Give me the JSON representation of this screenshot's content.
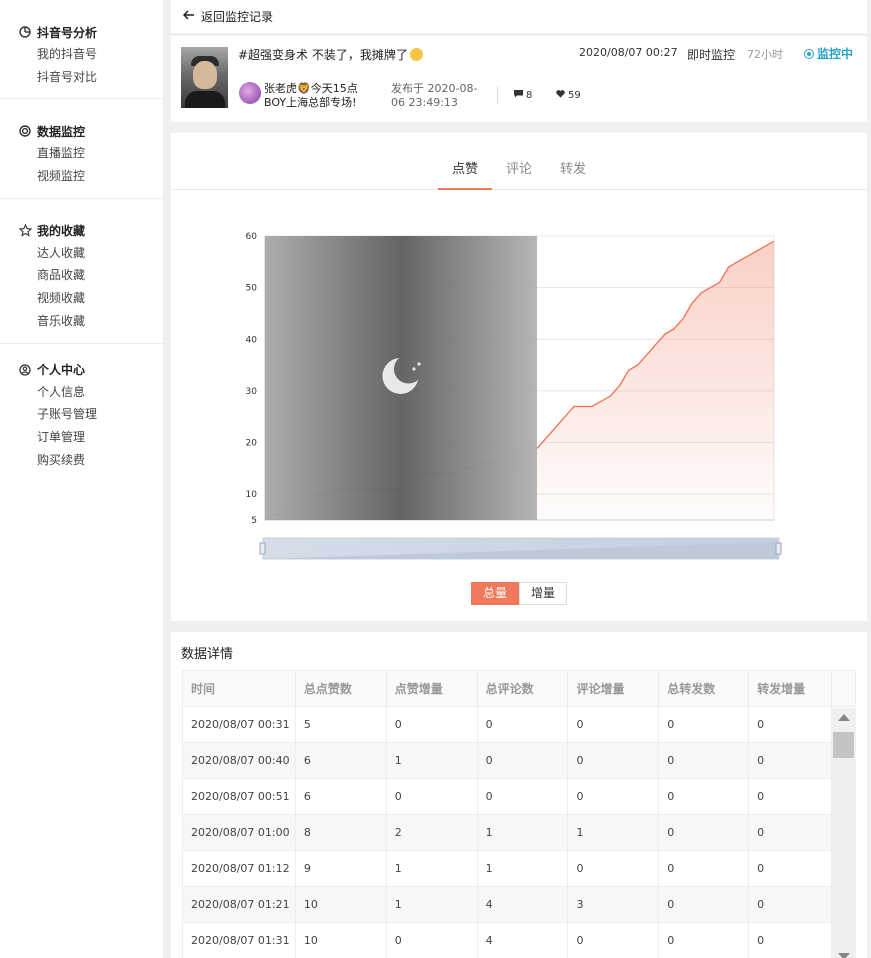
{
  "sidebar": {
    "groups": [
      {
        "title": "抖音号分析",
        "icon": "pie-chart-icon",
        "items": [
          "我的抖音号",
          "抖音号对比"
        ]
      },
      {
        "title": "数据监控",
        "icon": "spiral-icon",
        "items": [
          "直播监控",
          "视频监控"
        ]
      },
      {
        "title": "我的收藏",
        "icon": "star-icon",
        "items": [
          "达人收藏",
          "商品收藏",
          "视频收藏",
          "音乐收藏"
        ]
      },
      {
        "title": "个人中心",
        "icon": "user-circle-icon",
        "items": [
          "个人信息",
          "子账号管理",
          "订单管理",
          "购买续费"
        ]
      }
    ]
  },
  "header": {
    "back_label": "返回监控记录"
  },
  "video": {
    "title": "#超强变身术 不装了，我摊牌了",
    "author_name": "张老虎🦁今天15点BOY上海总部专场!",
    "published_label": "发布于 2020-08-06 23:49:13",
    "comments": "8",
    "likes": "59",
    "monitor_time": "2020/08/07 00:27",
    "monitor_type": "即时监控",
    "monitor_duration": "72小时",
    "monitor_status": "监控中"
  },
  "tabs": [
    "点赞",
    "评论",
    "转发"
  ],
  "active_tab": 0,
  "toggle": {
    "total_label": "总量",
    "delta_label": "增量"
  },
  "colors": {
    "accent": "#f0795b",
    "status": "#29a3c9"
  },
  "chart_data": {
    "type": "area",
    "y_ticks": [
      5,
      10,
      20,
      30,
      40,
      50,
      60
    ],
    "ylim": [
      5,
      60
    ],
    "series": [
      {
        "values": [
          5,
          6,
          6,
          8,
          9,
          10,
          10,
          10,
          11,
          11,
          11,
          11,
          11,
          11,
          11,
          11,
          12,
          14,
          14,
          14,
          14,
          14,
          15,
          15,
          16,
          16,
          18,
          18,
          18,
          18,
          19,
          21,
          23,
          25,
          27,
          27,
          27,
          28,
          29,
          31,
          34,
          35,
          37,
          39,
          41,
          42,
          44,
          47,
          49,
          50,
          51,
          54,
          55,
          56,
          57,
          58,
          59
        ]
      }
    ]
  },
  "table": {
    "title": "数据详情",
    "columns": [
      "时间",
      "总点赞数",
      "点赞增量",
      "总评论数",
      "评论增量",
      "总转发数",
      "转发增量"
    ],
    "rows": [
      [
        "2020/08/07 00:31",
        "5",
        "0",
        "0",
        "0",
        "0",
        "0"
      ],
      [
        "2020/08/07 00:40",
        "6",
        "1",
        "0",
        "0",
        "0",
        "0"
      ],
      [
        "2020/08/07 00:51",
        "6",
        "0",
        "0",
        "0",
        "0",
        "0"
      ],
      [
        "2020/08/07 01:00",
        "8",
        "2",
        "1",
        "1",
        "0",
        "0"
      ],
      [
        "2020/08/07 01:12",
        "9",
        "1",
        "1",
        "0",
        "0",
        "0"
      ],
      [
        "2020/08/07 01:21",
        "10",
        "1",
        "4",
        "3",
        "0",
        "0"
      ],
      [
        "2020/08/07 01:31",
        "10",
        "0",
        "4",
        "0",
        "0",
        "0"
      ]
    ]
  }
}
